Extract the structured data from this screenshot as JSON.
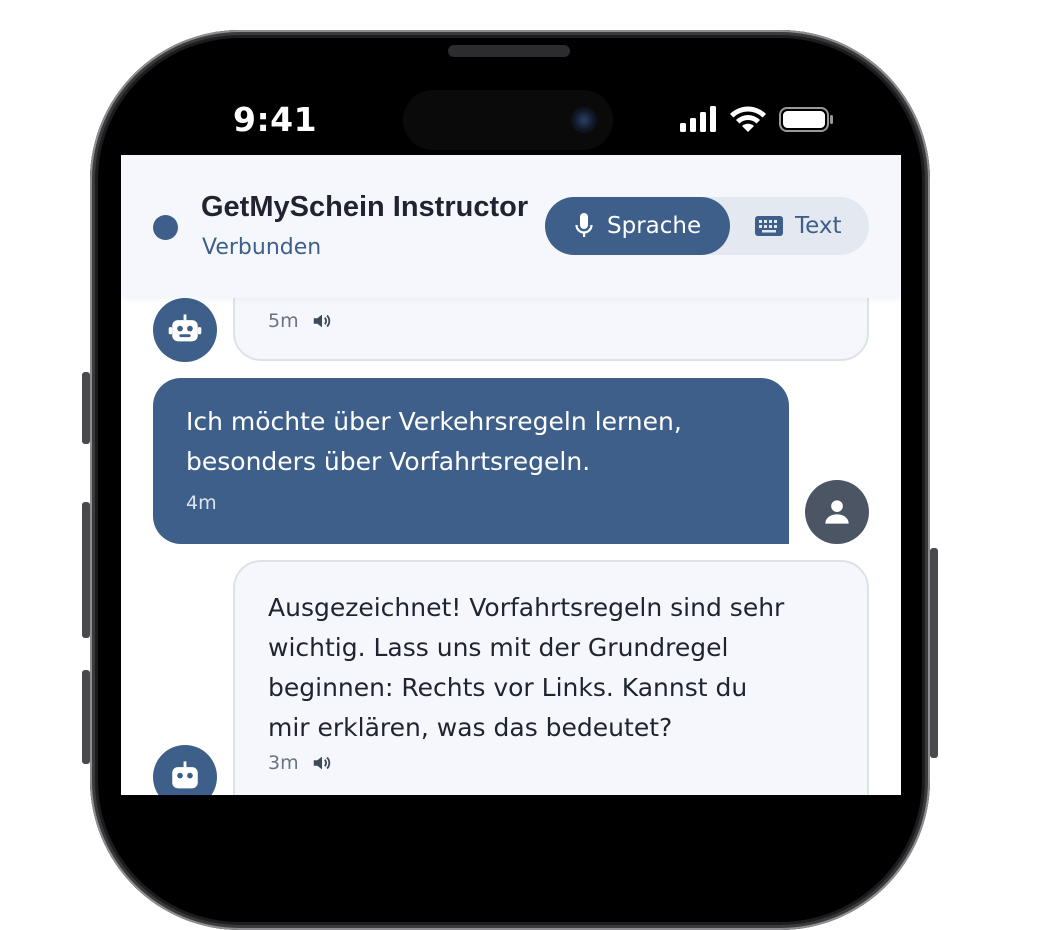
{
  "status_bar": {
    "time": "9:41"
  },
  "header": {
    "title": "GetMySchein Instructor",
    "status": "Verbunden",
    "mode_toggle": {
      "voice_label": "Sprache",
      "text_label": "Text",
      "selected": "Sprache"
    }
  },
  "messages": [
    {
      "sender": "bot",
      "text": "",
      "time": "5m",
      "has_audio": true
    },
    {
      "sender": "user",
      "lines": [
        "Ich möchte über Verkehrsregeln lernen,",
        "besonders über Vorfahrtsregeln."
      ],
      "time": "4m"
    },
    {
      "sender": "bot",
      "lines": [
        "Ausgezeichnet! Vorfahrtsregeln sind sehr",
        "wichtig. Lass uns mit der Grundregel",
        "beginnen: Rechts vor Links. Kannst du",
        "mir erklären, was das bedeutet?"
      ],
      "time": "3m",
      "has_audio": true
    }
  ],
  "colors": {
    "accent": "#3e5f89",
    "user_avatar": "#4b5563",
    "bot_bubble": "#f5f7fc"
  },
  "icons": [
    "microphone-icon",
    "keyboard-icon",
    "robot-icon",
    "person-icon",
    "speaker-icon"
  ]
}
